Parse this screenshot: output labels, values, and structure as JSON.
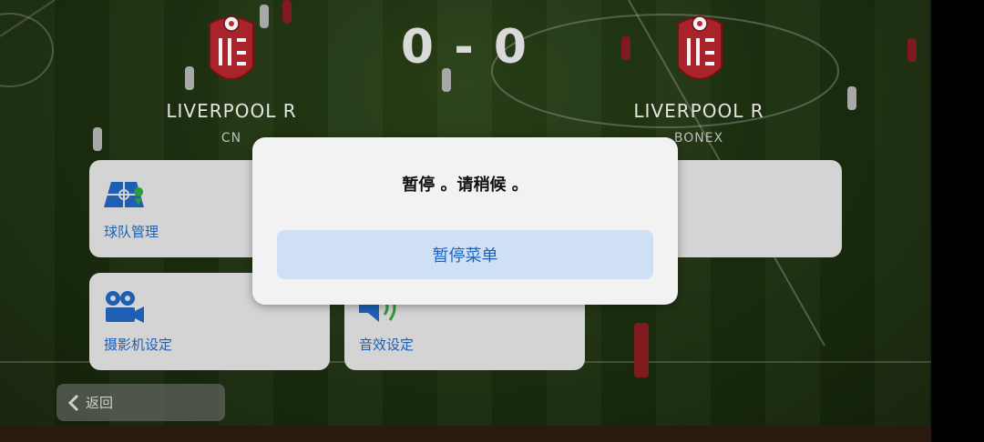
{
  "scoreboard": {
    "home": {
      "name": "LIVERPOOL R",
      "player": "CN"
    },
    "away": {
      "name": "LIVERPOOL R",
      "player": "BONEX"
    },
    "score": "0 - 0"
  },
  "menu": {
    "tiles": [
      {
        "label": "球队管理",
        "icon": "team-formation-icon"
      },
      {
        "label": "",
        "icon": ""
      },
      {
        "label": "摄影机设定",
        "icon": "camera-icon"
      },
      {
        "label": "音效设定",
        "icon": "speaker-icon"
      }
    ],
    "back_label": "返回"
  },
  "modal": {
    "message": "暂停 。请稍候 。",
    "button_label": "暂停菜单"
  },
  "colors": {
    "crest_red": "#c0282e",
    "accent_blue": "#1e5fb3",
    "modal_button_bg": "#cfe0f4"
  }
}
